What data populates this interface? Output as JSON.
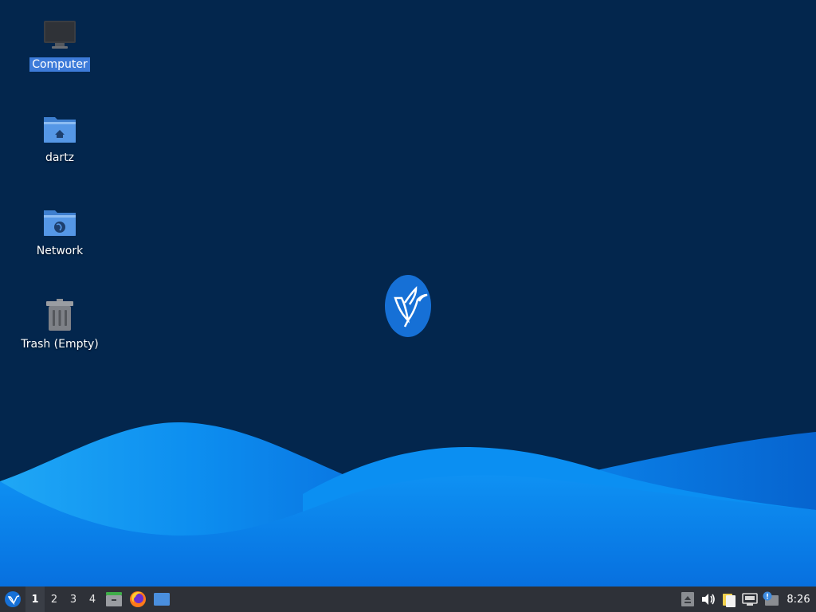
{
  "desktop": {
    "background_color": "#03264d",
    "icons": [
      {
        "label": "Computer",
        "icon": "computer-icon",
        "selected": true
      },
      {
        "label": "dartz",
        "icon": "home-folder-icon",
        "selected": false
      },
      {
        "label": "Network",
        "icon": "network-folder-icon",
        "selected": false
      },
      {
        "label": "Trash (Empty)",
        "icon": "trash-icon",
        "selected": false
      }
    ],
    "center_logo": "hummingbird-logo-icon"
  },
  "panel": {
    "background_color": "#2e3138",
    "menu_icon": "whisker-menu-icon",
    "workspaces": [
      "1",
      "2",
      "3",
      "4"
    ],
    "active_workspace": "1",
    "launchers": [
      {
        "name": "file-manager-icon"
      },
      {
        "name": "firefox-icon"
      },
      {
        "name": "show-desktop-icon"
      }
    ],
    "tray": [
      {
        "name": "eject-icon"
      },
      {
        "name": "volume-icon"
      },
      {
        "name": "clipboard-icon"
      },
      {
        "name": "network-wired-icon"
      },
      {
        "name": "updates-notification-icon"
      }
    ],
    "clock": "8:26"
  },
  "colors": {
    "wave_light": "#1aa3f2",
    "wave_mid": "#0b8cf0",
    "wave_dark": "#0671dc",
    "selection": "#3d7bd9",
    "folder_blue": "#4a8fde"
  }
}
